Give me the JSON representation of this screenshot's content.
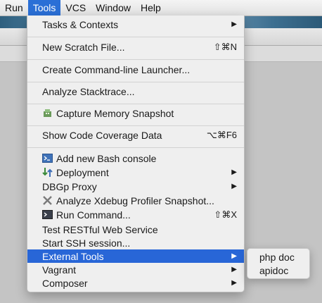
{
  "menubar": {
    "items": [
      {
        "label": "Run"
      },
      {
        "label": "Tools"
      },
      {
        "label": "VCS"
      },
      {
        "label": "Window"
      },
      {
        "label": "Help"
      }
    ]
  },
  "tools_menu": {
    "items": {
      "tasks_contexts": {
        "label": "Tasks & Contexts",
        "arrow": "▶"
      },
      "new_scratch": {
        "label": "New Scratch File...",
        "shortcut": "⇧⌘N"
      },
      "cmdline_launcher": {
        "label": "Create Command-line Launcher..."
      },
      "analyze_stacktrace": {
        "label": "Analyze Stacktrace..."
      },
      "capture_memory": {
        "label": "Capture Memory Snapshot",
        "icon": "memory-snapshot-icon"
      },
      "code_coverage": {
        "label": "Show Code Coverage Data",
        "shortcut": "⌥⌘F6"
      },
      "bash_console": {
        "label": "Add new Bash console",
        "icon": "terminal-icon"
      },
      "deployment": {
        "label": "Deployment",
        "icon": "deployment-icon",
        "arrow": "▶"
      },
      "dbgp_proxy": {
        "label": "DBGp Proxy",
        "arrow": "▶"
      },
      "xdebug_profiler": {
        "label": "Analyze Xdebug Profiler Snapshot...",
        "icon": "xdebug-icon"
      },
      "run_command": {
        "label": "Run Command...",
        "icon": "run-command-icon",
        "shortcut": "⇧⌘X"
      },
      "restful": {
        "label": "Test RESTful Web Service"
      },
      "ssh_session": {
        "label": "Start SSH session..."
      },
      "external_tools": {
        "label": "External Tools",
        "arrow": "▶"
      },
      "vagrant": {
        "label": "Vagrant",
        "arrow": "▶"
      },
      "composer": {
        "label": "Composer",
        "arrow": "▶"
      }
    }
  },
  "external_tools_submenu": {
    "items": [
      {
        "label": "php doc"
      },
      {
        "label": "apidoc"
      }
    ]
  },
  "colors": {
    "highlight": "#2866d7",
    "menu_bg": "#efefef"
  }
}
